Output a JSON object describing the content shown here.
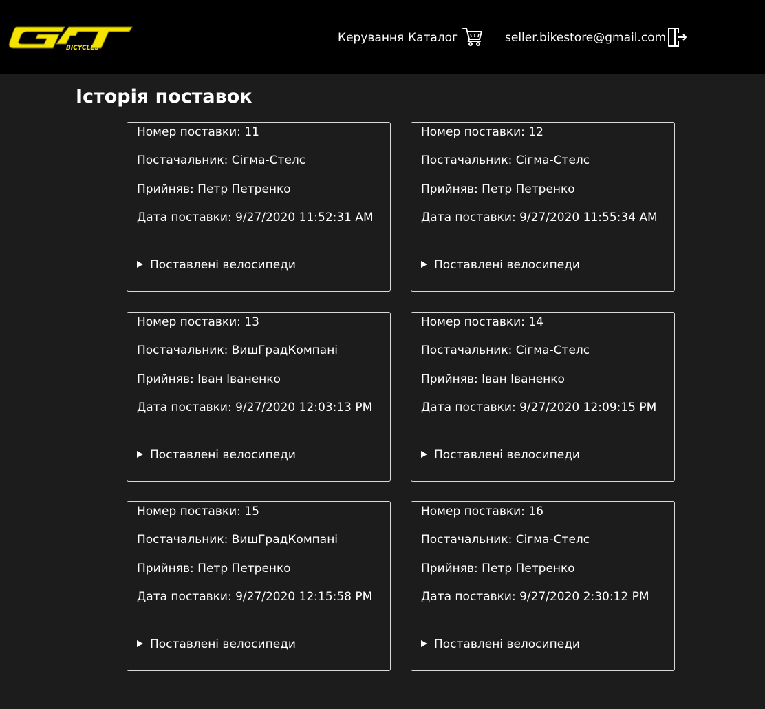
{
  "header": {
    "logo_text": "GT",
    "logo_subtext": "BICYCLES",
    "nav": {
      "manage_label": "Керування",
      "catalog_label": "Каталог"
    },
    "cart_icon": "shopping-cart-icon",
    "user_email": "seller.bikestore@gmail.com",
    "logout_icon": "logout-icon",
    "brand_color": "#f5e400"
  },
  "page": {
    "title": "Історія поставок"
  },
  "labels": {
    "number": "Номер поставки:",
    "supplier": "Постачальник:",
    "accepted_by": "Прийняв:",
    "date": "Дата поставки:",
    "details": "Поставлені велосипеди"
  },
  "deliveries": [
    {
      "number": "11",
      "supplier": "Сігма-Стелс",
      "accepted_by": "Петр Петренко",
      "date": "9/27/2020 11:52:31 AM"
    },
    {
      "number": "12",
      "supplier": "Сігма-Стелс",
      "accepted_by": "Петр Петренко",
      "date": "9/27/2020 11:55:34 AM"
    },
    {
      "number": "13",
      "supplier": "ВишГрадКомпані",
      "accepted_by": "Іван Іваненко",
      "date": "9/27/2020 12:03:13 PM"
    },
    {
      "number": "14",
      "supplier": "Сігма-Стелс",
      "accepted_by": "Іван Іваненко",
      "date": "9/27/2020 12:09:15 PM"
    },
    {
      "number": "15",
      "supplier": "ВишГрадКомпані",
      "accepted_by": "Петр Петренко",
      "date": "9/27/2020 12:15:58 PM"
    },
    {
      "number": "16",
      "supplier": "Сігма-Стелс",
      "accepted_by": "Петр Петренко",
      "date": "9/27/2020 2:30:12 PM"
    }
  ]
}
